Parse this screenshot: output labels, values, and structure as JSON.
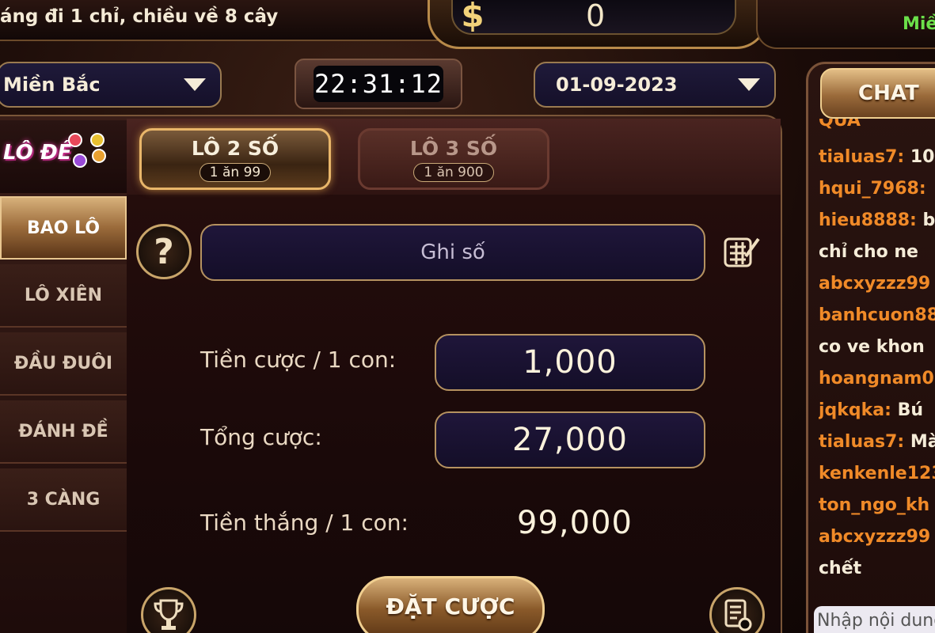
{
  "header": {
    "marquee": "áng đi 1 chỉ, chiều về 8 cây",
    "balance": "0",
    "region_status": "Miề"
  },
  "controls": {
    "region": "Miền Bắc",
    "clock": "22:31:12",
    "date": "01-09-2023"
  },
  "logo": {
    "text": "LÔ ĐỀ"
  },
  "tabs": [
    {
      "title": "LÔ 2 SỐ",
      "odds": "1 ăn 99",
      "active": true
    },
    {
      "title": "LÔ 3 SỐ",
      "odds": "1 ăn 900",
      "active": false
    }
  ],
  "sidebar": {
    "items": [
      {
        "label": "BAO LÔ",
        "active": true
      },
      {
        "label": "LÔ XIÊN",
        "active": false
      },
      {
        "label": "ĐẦU ĐUÔI",
        "active": false
      },
      {
        "label": "ĐÁNH ĐỀ",
        "active": false
      },
      {
        "label": "3 CÀNG",
        "active": false
      }
    ]
  },
  "form": {
    "help_symbol": "?",
    "number_placeholder": "Ghi số",
    "bet_per_label": "Tiền cược / 1 con:",
    "bet_per_value": "1,000",
    "total_label": "Tổng cược:",
    "total_value": "27,000",
    "win_label": "Tiền thắng / 1 con:",
    "win_value": "99,000",
    "submit_label": "ĐẶT CƯỢC"
  },
  "chat": {
    "title": "CHAT",
    "input_placeholder": "Nhập nội dung",
    "messages": [
      {
        "user": "",
        "text": "QUA"
      },
      {
        "user": "tialuas7:",
        "text": " 10"
      },
      {
        "user": "hqui_7968:",
        "text": ""
      },
      {
        "user": "hieu8888:",
        "text": " b"
      },
      {
        "user": "",
        "text": "chỉ cho ne"
      },
      {
        "user": "abcxyzzz99",
        "text": ""
      },
      {
        "user": "banhcuon88",
        "text": ""
      },
      {
        "user": "",
        "text": "co ve khon"
      },
      {
        "user": "hoangnam0",
        "text": ""
      },
      {
        "user": "jqkqka:",
        "text": " Bú"
      },
      {
        "user": "tialuas7:",
        "text": " Mà"
      },
      {
        "user": "kenkenle123",
        "text": ""
      },
      {
        "user": "ton_ngo_kh",
        "text": ""
      },
      {
        "user": "abcxyzzz99",
        "text": ""
      },
      {
        "user": "",
        "text": "chết"
      }
    ]
  },
  "colors": {
    "accent_gold": "#e9b66a",
    "chat_user": "#f08a28",
    "region_status": "#6be04a"
  },
  "icons": {
    "balance": "dollar-icon",
    "dropdown": "triangle-down-icon",
    "edit": "edit-grid-icon",
    "trophy": "trophy-icon",
    "history": "history-icon"
  }
}
